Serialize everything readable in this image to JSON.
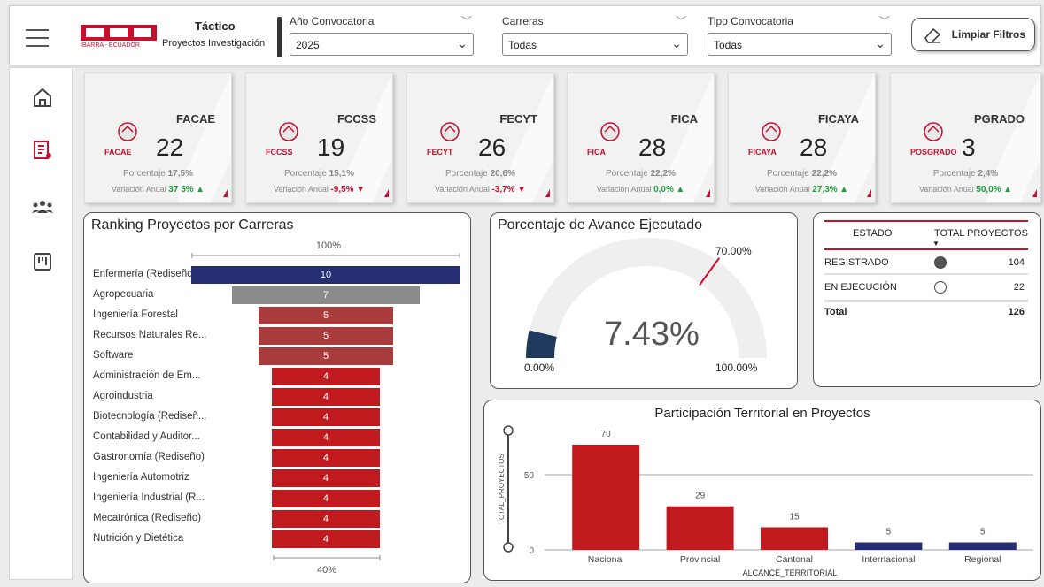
{
  "header": {
    "logo_text": "UTN",
    "logo_sub": "IBARRA - ECUADOR",
    "title": "Táctico",
    "subtitle": "Proyectos Investigación"
  },
  "slicers": [
    {
      "label": "Año Convocatoria",
      "value": "2025"
    },
    {
      "label": "Carreras",
      "value": "Todas"
    },
    {
      "label": "Tipo Convocatoria",
      "value": "Todas"
    }
  ],
  "clear_button": "Limpiar Filtros",
  "nav": [
    "home-icon",
    "report-icon",
    "people-icon",
    "board-icon"
  ],
  "cards": [
    {
      "code": "FACAE",
      "value": "22",
      "pct_label": "Porcentaje",
      "pct": "17,5%",
      "var_label": "Variación Anual",
      "var": "37 5%",
      "dir": "up",
      "icon_label": "FACAE"
    },
    {
      "code": "FCCSS",
      "value": "19",
      "pct_label": "Porcentaje",
      "pct": "15,1%",
      "var_label": "Variación Anual",
      "var": "-9,5%",
      "dir": "down",
      "icon_label": "FCCSS"
    },
    {
      "code": "FECYT",
      "value": "26",
      "pct_label": "Porcentaje",
      "pct": "20,6%",
      "var_label": "Variación Anual",
      "var": "-3,7%",
      "dir": "down",
      "icon_label": "FECYT"
    },
    {
      "code": "FICA",
      "value": "28",
      "pct_label": "Porcentaje",
      "pct": "22,2%",
      "var_label": "Variación Anual",
      "var": "0,0%",
      "dir": "up",
      "icon_label": "FICA"
    },
    {
      "code": "FICAYA",
      "value": "28",
      "pct_label": "Porcentaje",
      "pct": "22,2%",
      "var_label": "Variación Anual",
      "var": "27,3%",
      "dir": "up",
      "icon_label": "FICAYA"
    },
    {
      "code": "PGRADO",
      "value": "3",
      "pct_label": "Porcentaje",
      "pct": "2,4%",
      "var_label": "Variación Anual",
      "var": "50,0%",
      "dir": "up",
      "icon_label": "POSGRADO"
    }
  ],
  "chart_data": [
    {
      "type": "bar",
      "title": "Ranking Proyectos por Carreras",
      "top_label": "100%",
      "bottom_label": "40%",
      "categories": [
        "Enfermería (Rediseño",
        "Agropecuaria",
        "Ingeniería Forestal",
        "Recursos Naturales Re...",
        "Software",
        "Administración de Em...",
        "Agroindustria",
        "Biotecnología (Rediseñ...",
        "Contabilidad y Auditor...",
        "Gastronomía (Rediseño)",
        "Ingeniería Automotriz",
        "Ingeniería Industrial (R...",
        "Mecatrónica (Rediseño)",
        "Nutrición y Dietética"
      ],
      "values": [
        10,
        7,
        5,
        5,
        5,
        4,
        4,
        4,
        4,
        4,
        4,
        4,
        4,
        4
      ],
      "colors": [
        "#252d73",
        "#8a8a8a",
        "#a83c3c",
        "#a83c3c",
        "#a83c3c",
        "#c01a1f",
        "#c01a1f",
        "#c01a1f",
        "#c01a1f",
        "#c01a1f",
        "#c01a1f",
        "#c01a1f",
        "#c01a1f",
        "#c01a1f"
      ]
    },
    {
      "type": "gauge",
      "title": "Porcentaje de Avance Ejecutado",
      "value": 7.43,
      "value_label": "7.43%",
      "min_label": "0.00%",
      "max_label": "100.00%",
      "target": 70,
      "target_label": "70.00%",
      "fill_color": "#1f3a5c",
      "track_color": "#f0efef",
      "target_color": "#c8102e"
    },
    {
      "type": "table",
      "columns": [
        "ESTADO",
        "TOTAL PROYECTOS"
      ],
      "rows": [
        {
          "estado": "REGISTRADO",
          "status": "filled",
          "total": "104"
        },
        {
          "estado": "EN EJECUCIÓN",
          "status": "empty",
          "total": "22"
        }
      ],
      "total_label": "Total",
      "total_value": "126"
    },
    {
      "type": "bar",
      "title": "Participación Territorial en Proyectos",
      "xlabel": "ALCANCE_TERRITORIAL",
      "ylabel": "TOTAL_PROYECTOS",
      "categories": [
        "Nacional",
        "Provincial",
        "Cantonal",
        "Internacional",
        "Regional"
      ],
      "values": [
        70,
        29,
        15,
        5,
        5
      ],
      "colors": [
        "#c01a1f",
        "#c01a1f",
        "#c01a1f",
        "#252d73",
        "#252d73"
      ],
      "y_ticks": [
        0,
        50
      ],
      "ylim": [
        0,
        80
      ]
    }
  ]
}
